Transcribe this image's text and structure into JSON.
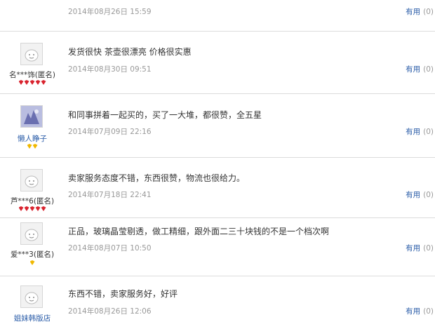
{
  "reviews": [
    {
      "user": "",
      "text": "",
      "date": "2014年08月26日 15:59",
      "helpful_label": "有用",
      "helpful_count": "(0)",
      "badges": []
    },
    {
      "user": "名***饰(匿名)",
      "text": "发货很快 茶壶很漂亮 价格很实惠",
      "date": "2014年08月30日 09:51",
      "helpful_label": "有用",
      "helpful_count": "(0)",
      "badges": [
        "red",
        "red",
        "red",
        "red",
        "red"
      ]
    },
    {
      "user": "懒人睁子",
      "text": "和同事拼着一起买的，买了一大堆，都很赞，全五星",
      "date": "2014年07月09日 22:16",
      "helpful_label": "有用",
      "helpful_count": "(0)",
      "badges": [
        "gold",
        "gold"
      ]
    },
    {
      "user": "芦***6(匿名)",
      "text": "卖家服务态度不错，东西很赞，物流也很给力。",
      "date": "2014年07月18日 22:41",
      "helpful_label": "有用",
      "helpful_count": "(0)",
      "badges": [
        "red",
        "red",
        "red",
        "red",
        "red"
      ]
    },
    {
      "user": "爱***3(匿名)",
      "text": "正品，玻璃晶莹剔透，做工精细，跟外面二三十块钱的不是一个档次啊",
      "date": "2014年08月07日 10:50",
      "helpful_label": "有用",
      "helpful_count": "(0)",
      "badges": [
        "gold"
      ]
    },
    {
      "user": "姐妹韩版店",
      "text": "东西不错，卖家服务好，好评",
      "date": "2014年08月26日 12:06",
      "helpful_label": "有用",
      "helpful_count": "(0)",
      "badges": []
    }
  ],
  "colors": {
    "link": "#2a5ca8",
    "muted": "#999999",
    "badge_red": "#d9232e",
    "badge_gold": "#f0b800"
  }
}
